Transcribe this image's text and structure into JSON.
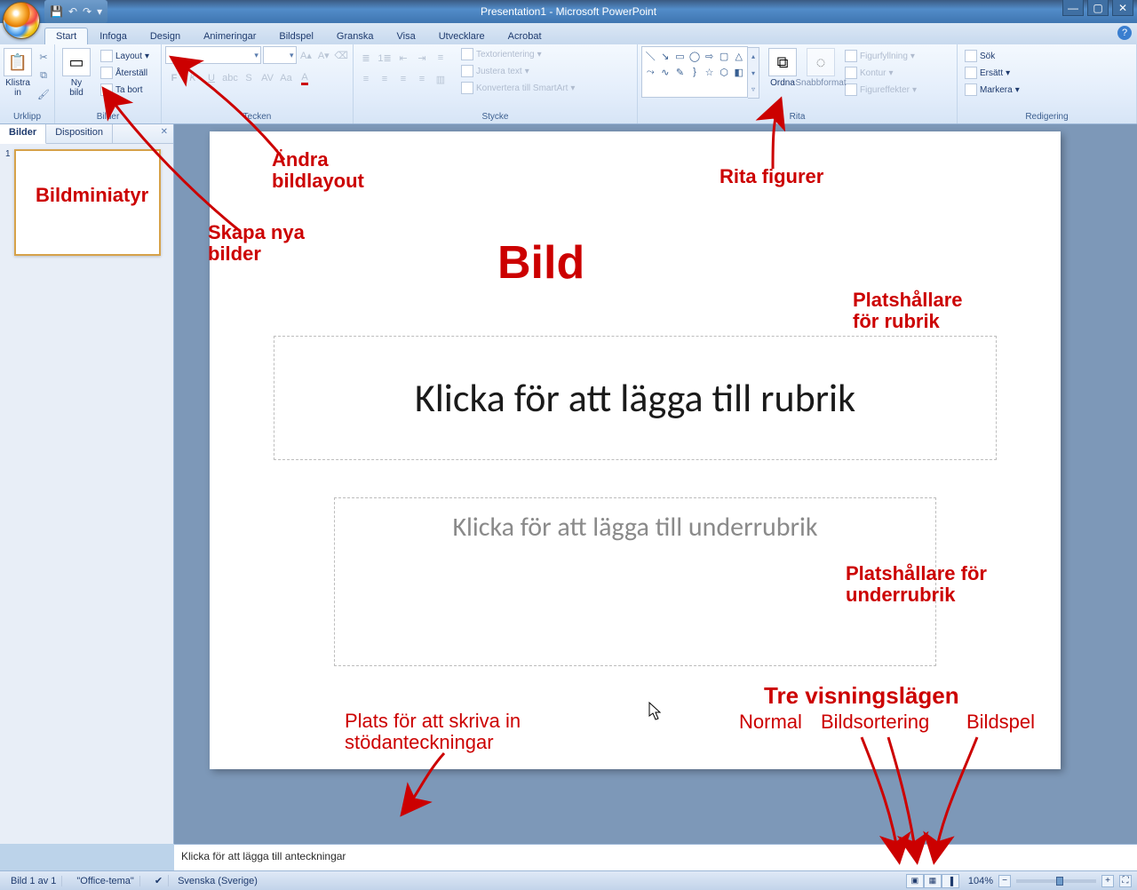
{
  "window": {
    "title": "Presentation1 - Microsoft PowerPoint"
  },
  "qat": {
    "save": "💾",
    "undo": "↶",
    "redo": "↷",
    "more": "▾"
  },
  "tabs": {
    "items": [
      "Start",
      "Infoga",
      "Design",
      "Animeringar",
      "Bildspel",
      "Granska",
      "Visa",
      "Utvecklare",
      "Acrobat"
    ],
    "active": 0
  },
  "ribbon": {
    "clipboard": {
      "label": "Urklipp",
      "paste": "Klistra\nin"
    },
    "slides": {
      "label": "Bilder",
      "new": "Ny\nbild",
      "layout": "Layout",
      "reset": "Återställ",
      "delete": "Ta bort"
    },
    "font": {
      "label": "Tecken",
      "name_ph": "",
      "size_ph": ""
    },
    "para": {
      "label": "Stycke",
      "textdir": "Textorientering",
      "align": "Justera text",
      "smartart": "Konvertera till SmartArt"
    },
    "drawing": {
      "label": "Rita",
      "arrange": "Ordna",
      "quick": "Snabbformat",
      "fill": "Figurfyllning",
      "outline": "Kontur",
      "effects": "Figureffekter"
    },
    "editing": {
      "label": "Redigering",
      "find": "Sök",
      "replace": "Ersätt",
      "select": "Markera"
    }
  },
  "side": {
    "tab_slides": "Bilder",
    "tab_outline": "Disposition",
    "slide_num": "1"
  },
  "slide": {
    "title_ph": "Klicka för att lägga till rubrik",
    "sub_ph": "Klicka för att lägga till underrubrik"
  },
  "notes": {
    "placeholder": "Klicka för att lägga till anteckningar"
  },
  "status": {
    "slide": "Bild 1 av 1",
    "theme": "\"Office-tema\"",
    "lang": "Svenska (Sverige)",
    "zoom": "104%"
  },
  "annotations": {
    "thumb": "Bildminiatyr",
    "layout": "Ändra\nbildlayout",
    "newslide": "Skapa nya\nbilder",
    "shapes": "Rita figurer",
    "bild": "Bild",
    "ph_title": "Platshållare\nför rubrik",
    "ph_sub": "Platshållare för\nunderrubrik",
    "notes": "Plats för att skriva in\nstödanteckningar",
    "views_title": "Tre visningslägen",
    "view_normal": "Normal",
    "view_sorter": "Bildsortering",
    "view_show": "Bildspel"
  }
}
